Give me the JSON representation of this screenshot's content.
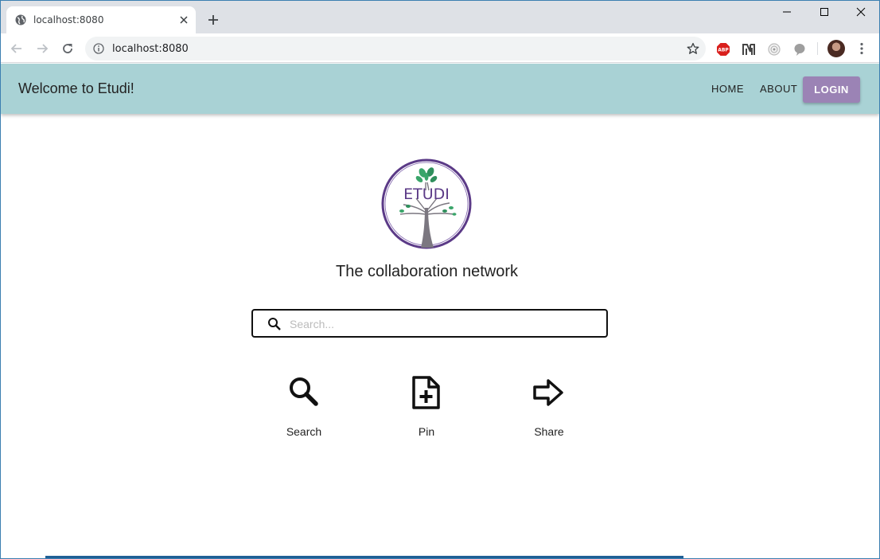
{
  "browser": {
    "tab_title": "localhost:8080",
    "url": "localhost:8080",
    "extensions": [
      "adblock-icon",
      "extension-n-icon",
      "extension-circle-icon",
      "extension-bubble-icon"
    ]
  },
  "header": {
    "brand": "Welcome to Etudi!",
    "nav": {
      "home": "HOME",
      "about": "ABOUT",
      "login": "LOGIN"
    }
  },
  "hero": {
    "logo_text": "ETUDI",
    "tagline": "The collaboration network"
  },
  "search": {
    "placeholder": "Search...",
    "value": ""
  },
  "features": [
    {
      "label": "Search",
      "icon": "search-icon"
    },
    {
      "label": "Pin",
      "icon": "add-document-icon"
    },
    {
      "label": "Share",
      "icon": "share-arrow-icon"
    }
  ],
  "colors": {
    "appbar": "#a9d2d5",
    "login_button": "#9b83b5",
    "logo_ring": "#5b3a87"
  }
}
